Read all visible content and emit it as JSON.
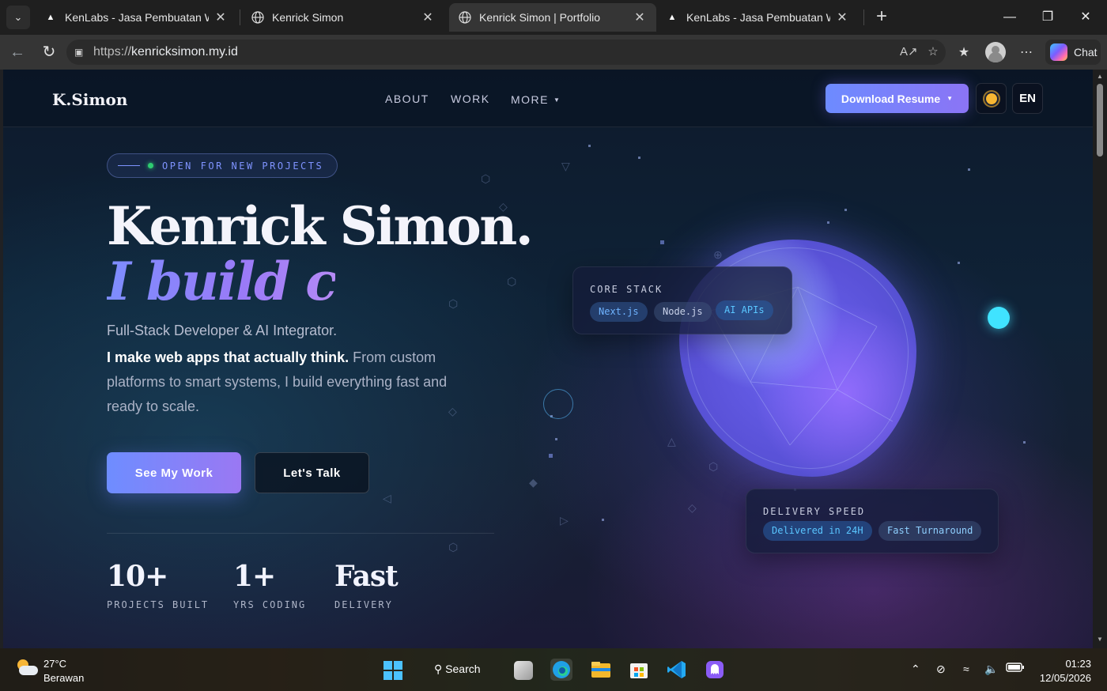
{
  "browser": {
    "tabs": [
      {
        "title": "KenLabs - Jasa Pembuatan Website",
        "favicon": "triangle-icon",
        "active": false
      },
      {
        "title": "Kenrick Simon",
        "favicon": "globe-icon",
        "active": false
      },
      {
        "title": "Kenrick Simon | Portfolio",
        "favicon": "globe-icon",
        "active": true
      },
      {
        "title": "KenLabs - Jasa Pembuatan Website",
        "favicon": "triangle-icon",
        "active": false
      }
    ],
    "url_protocol": "https://",
    "url_host": "kenricksimon.my.id",
    "chat_label": "Chat"
  },
  "site": {
    "logo": "K.Simon",
    "nav": {
      "about": "ABOUT",
      "work": "WORK",
      "more": "MORE"
    },
    "resume_button": "Download Resume",
    "lang_button": "EN",
    "badge": "OPEN FOR NEW PROJECTS",
    "title_line1": "Kenrick Simon.",
    "title_line2": "I build c",
    "subtitle": "Full-Stack Developer & AI Integrator.",
    "desc_bold": "I make web apps that actually think.",
    "desc_rest": " From custom platforms to smart systems, I build everything fast and ready to scale.",
    "cta_primary": "See My Work",
    "cta_secondary": "Let's Talk",
    "stats": [
      {
        "value": "10+",
        "label": "PROJECTS BUILT"
      },
      {
        "value": "1+",
        "label": "YRS CODING"
      },
      {
        "value": "Fast",
        "label": "DELIVERY"
      }
    ],
    "core_stack": {
      "label": "CORE STACK",
      "chips": [
        "Next.js",
        "Node.js",
        "AI APIs"
      ]
    },
    "delivery_speed": {
      "label": "DELIVERY SPEED",
      "chips": [
        "Delivered in 24H",
        "Fast Turnaround"
      ]
    }
  },
  "taskbar": {
    "temperature": "27°C",
    "condition": "Berawan",
    "search_label": "Search",
    "time": "01:23",
    "date": "12/05/2026"
  },
  "colors": {
    "accent": "#6e8dff",
    "accent_purple": "#9a78f3",
    "status_green": "#2ecc71",
    "cyan": "#40e3ff"
  }
}
